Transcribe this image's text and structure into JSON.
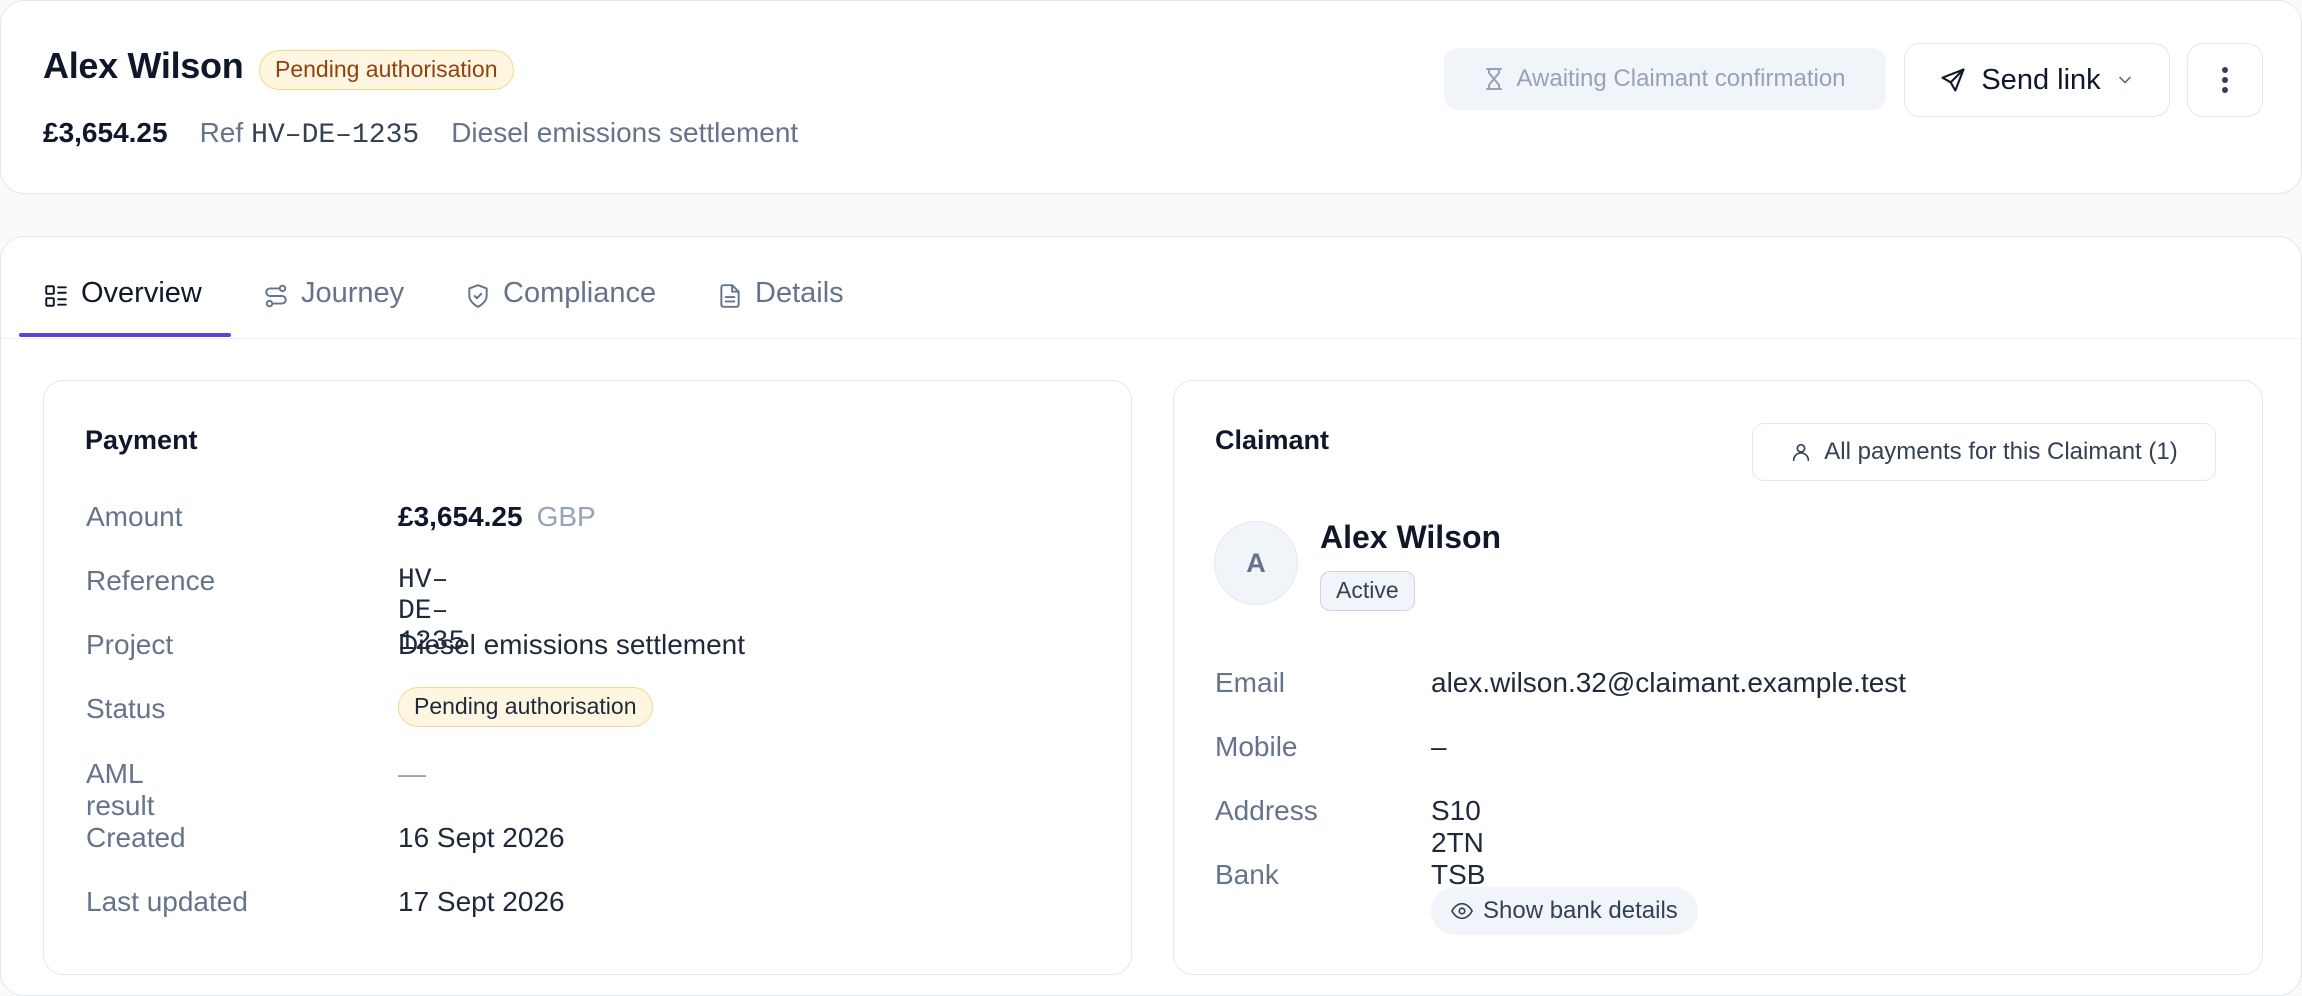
{
  "header": {
    "name": "Alex Wilson",
    "status_badge": "Pending authorisation",
    "amount": "£3,654.25",
    "ref_label": "Ref",
    "ref_value": "HV–DE–1235",
    "project": "Diesel emissions settlement",
    "awaiting_label": "Awaiting Claimant confirmation",
    "send_link_label": "Send link"
  },
  "tabs": [
    {
      "label": "Overview",
      "icon": "list-icon",
      "active": true
    },
    {
      "label": "Journey",
      "icon": "route-icon",
      "active": false
    },
    {
      "label": "Compliance",
      "icon": "shield-check-icon",
      "active": false
    },
    {
      "label": "Details",
      "icon": "document-icon",
      "active": false
    }
  ],
  "payment": {
    "title": "Payment",
    "rows": [
      {
        "label": "Amount",
        "value": "£3,654.25",
        "currency": "GBP"
      },
      {
        "label": "Reference",
        "value": "HV–DE–1235"
      },
      {
        "label": "Project",
        "value": "Diesel emissions settlement"
      },
      {
        "label": "Status",
        "value": "Pending authorisation"
      },
      {
        "label": "AML result",
        "value": "—"
      },
      {
        "label": "Created",
        "value": "16 Sept 2026"
      },
      {
        "label": "Last updated",
        "value": "17 Sept 2026"
      }
    ]
  },
  "claimant": {
    "title": "Claimant",
    "all_payments_label": "All payments for this Claimant (1)",
    "avatar_initial": "A",
    "name": "Alex Wilson",
    "status": "Active",
    "rows": [
      {
        "label": "Email",
        "value": "alex.wilson.32@claimant.example.test"
      },
      {
        "label": "Mobile",
        "value": "–"
      },
      {
        "label": "Address",
        "value": "S10 2TN"
      },
      {
        "label": "Bank",
        "value": "TSB"
      }
    ],
    "show_bank_label": "Show bank details"
  },
  "colors": {
    "accent": "#5b45d6",
    "pending_bg": "#fef6e0",
    "pending_text": "#92400e",
    "muted_text": "#64748b"
  }
}
